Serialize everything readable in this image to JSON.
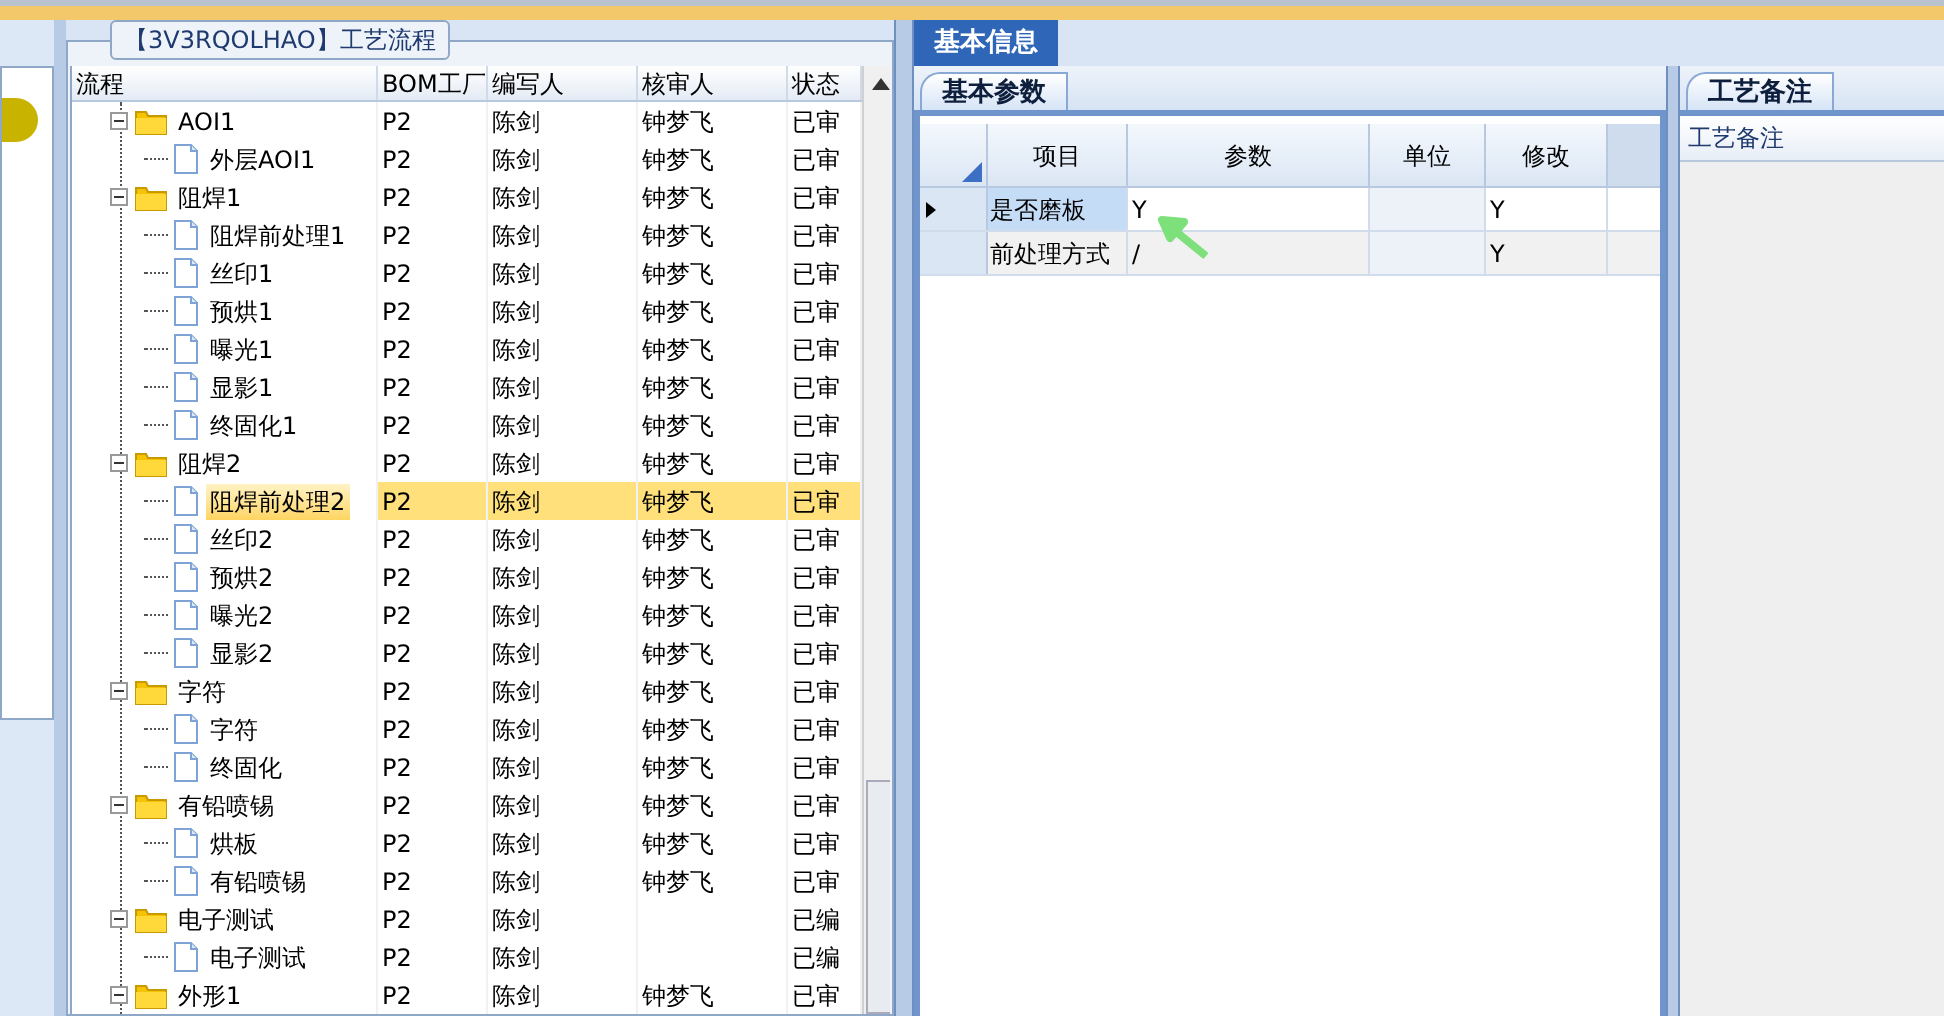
{
  "flow_panel": {
    "title": "【3V3RQOLHAO】工艺流程",
    "columns": [
      "流程",
      "BOM工厂",
      "编写人",
      "核审人",
      "状态"
    ],
    "tree": [
      {
        "kind": "folder",
        "name": "AOI1",
        "factory": "P2",
        "author": "陈剑",
        "reviewer": "钟梦飞",
        "status": "已审",
        "expanded": true,
        "selected": false,
        "children": [
          {
            "kind": "file",
            "name": "外层AOI1",
            "factory": "P2",
            "author": "陈剑",
            "reviewer": "钟梦飞",
            "status": "已审",
            "selected": false
          }
        ]
      },
      {
        "kind": "folder",
        "name": "阻焊1",
        "factory": "P2",
        "author": "陈剑",
        "reviewer": "钟梦飞",
        "status": "已审",
        "expanded": true,
        "selected": false,
        "children": [
          {
            "kind": "file",
            "name": "阻焊前处理1",
            "factory": "P2",
            "author": "陈剑",
            "reviewer": "钟梦飞",
            "status": "已审",
            "selected": false
          },
          {
            "kind": "file",
            "name": "丝印1",
            "factory": "P2",
            "author": "陈剑",
            "reviewer": "钟梦飞",
            "status": "已审",
            "selected": false
          },
          {
            "kind": "file",
            "name": "预烘1",
            "factory": "P2",
            "author": "陈剑",
            "reviewer": "钟梦飞",
            "status": "已审",
            "selected": false
          },
          {
            "kind": "file",
            "name": "曝光1",
            "factory": "P2",
            "author": "陈剑",
            "reviewer": "钟梦飞",
            "status": "已审",
            "selected": false
          },
          {
            "kind": "file",
            "name": "显影1",
            "factory": "P2",
            "author": "陈剑",
            "reviewer": "钟梦飞",
            "status": "已审",
            "selected": false
          },
          {
            "kind": "file",
            "name": "终固化1",
            "factory": "P2",
            "author": "陈剑",
            "reviewer": "钟梦飞",
            "status": "已审",
            "selected": false
          }
        ]
      },
      {
        "kind": "folder",
        "name": "阻焊2",
        "factory": "P2",
        "author": "陈剑",
        "reviewer": "钟梦飞",
        "status": "已审",
        "expanded": true,
        "selected": false,
        "children": [
          {
            "kind": "file",
            "name": "阻焊前处理2",
            "factory": "P2",
            "author": "陈剑",
            "reviewer": "钟梦飞",
            "status": "已审",
            "selected": true
          },
          {
            "kind": "file",
            "name": "丝印2",
            "factory": "P2",
            "author": "陈剑",
            "reviewer": "钟梦飞",
            "status": "已审",
            "selected": false
          },
          {
            "kind": "file",
            "name": "预烘2",
            "factory": "P2",
            "author": "陈剑",
            "reviewer": "钟梦飞",
            "status": "已审",
            "selected": false
          },
          {
            "kind": "file",
            "name": "曝光2",
            "factory": "P2",
            "author": "陈剑",
            "reviewer": "钟梦飞",
            "status": "已审",
            "selected": false
          },
          {
            "kind": "file",
            "name": "显影2",
            "factory": "P2",
            "author": "陈剑",
            "reviewer": "钟梦飞",
            "status": "已审",
            "selected": false
          }
        ]
      },
      {
        "kind": "folder",
        "name": "字符",
        "factory": "P2",
        "author": "陈剑",
        "reviewer": "钟梦飞",
        "status": "已审",
        "expanded": true,
        "selected": false,
        "children": [
          {
            "kind": "file",
            "name": "字符",
            "factory": "P2",
            "author": "陈剑",
            "reviewer": "钟梦飞",
            "status": "已审",
            "selected": false
          },
          {
            "kind": "file",
            "name": "终固化",
            "factory": "P2",
            "author": "陈剑",
            "reviewer": "钟梦飞",
            "status": "已审",
            "selected": false
          }
        ]
      },
      {
        "kind": "folder",
        "name": "有铅喷锡",
        "factory": "P2",
        "author": "陈剑",
        "reviewer": "钟梦飞",
        "status": "已审",
        "expanded": true,
        "selected": false,
        "children": [
          {
            "kind": "file",
            "name": "烘板",
            "factory": "P2",
            "author": "陈剑",
            "reviewer": "钟梦飞",
            "status": "已审",
            "selected": false
          },
          {
            "kind": "file",
            "name": "有铅喷锡",
            "factory": "P2",
            "author": "陈剑",
            "reviewer": "钟梦飞",
            "status": "已审",
            "selected": false
          }
        ]
      },
      {
        "kind": "folder",
        "name": "电子测试",
        "factory": "P2",
        "author": "陈剑",
        "status": "已编",
        "expanded": true,
        "selected": false,
        "children": [
          {
            "kind": "file",
            "name": "电子测试",
            "factory": "P2",
            "author": "陈剑",
            "status": "已编",
            "selected": false
          }
        ]
      },
      {
        "kind": "folder",
        "name": "外形1",
        "factory": "P2",
        "author": "陈剑",
        "reviewer": "钟梦飞",
        "status": "已审",
        "expanded": true,
        "selected": false
      }
    ]
  },
  "main_tabs": [
    {
      "label": "基本信息",
      "selected": true
    }
  ],
  "param_tabs": [
    {
      "label": "基本参数",
      "selected": true
    }
  ],
  "param_grid": {
    "columns": [
      "项目",
      "参数",
      "单位",
      "修改"
    ],
    "rows": [
      {
        "item": "是否磨板",
        "param": "Y",
        "modify": "Y",
        "current": true,
        "selected": true
      },
      {
        "item": "前处理方式",
        "param": "/",
        "modify": "Y",
        "current": false,
        "selected": false
      }
    ]
  },
  "notes_tabs": [
    {
      "label": "工艺备注",
      "selected": true
    }
  ],
  "notes_label": "工艺备注"
}
